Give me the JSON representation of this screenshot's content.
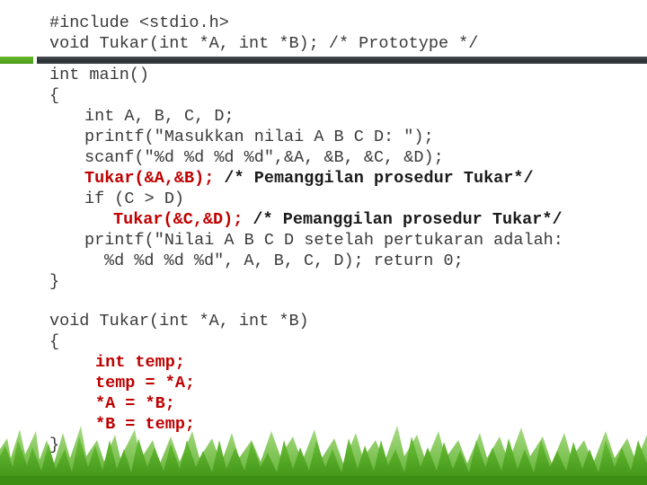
{
  "slide": {
    "header_lines": [
      "#include <stdio.h>",
      "void Tukar(int *A, int *B); /* Prototype */"
    ],
    "main_function": {
      "signature": "int main()",
      "open_brace": "{",
      "decl": "int A, B, C, D;",
      "printf_prompt": "printf(\"Masukkan nilai A B C D: \");",
      "scanf": "scanf(\"%d %d %d %d\",&A, &B, &C, &D);",
      "call1_code": "Tukar(&A,&B);",
      "call1_comment": " /* Pemanggilan prosedur Tukar*/",
      "if_stmt": "if (C > D)",
      "call2_code": "Tukar(&C,&D);",
      "call2_comment": " /* Pemanggilan prosedur Tukar*/",
      "printf_result_1": "printf(\"Nilai A B C D setelah pertukaran adalah:",
      "printf_result_2": "%d %d %d %d\", A, B, C, D); return 0;",
      "close_brace": "}"
    },
    "tukar_function": {
      "signature": "void Tukar(int *A, int *B)",
      "open_brace": "{",
      "body": [
        "int temp;",
        "temp = *A;",
        "*A = *B;",
        "*B = temp;"
      ],
      "close_brace": "}"
    },
    "colors": {
      "code_text": "#3a3a3a",
      "highlight_red": "#c00000",
      "divider_green": "#5aa922",
      "divider_dark": "#33383d",
      "grass_green": "#4aa01c"
    }
  }
}
